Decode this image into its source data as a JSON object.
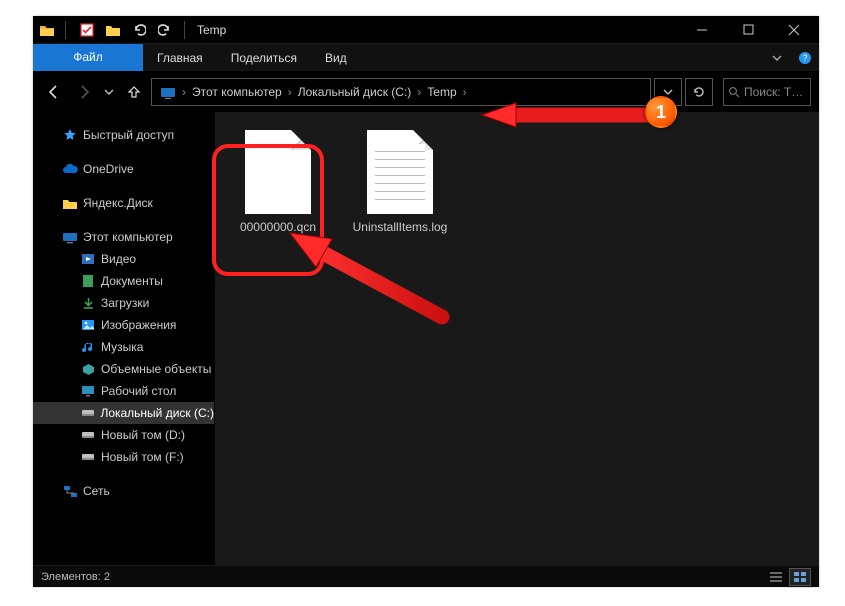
{
  "titlebar": {
    "title": "Temp"
  },
  "ribbon": {
    "file": "Файл",
    "home": "Главная",
    "share": "Поделиться",
    "view": "Вид"
  },
  "breadcrumbs": {
    "items": [
      "Этот компьютер",
      "Локальный диск (C:)",
      "Temp"
    ]
  },
  "search": {
    "placeholder": "Поиск: T…"
  },
  "nav": {
    "quick": "Быстрый доступ",
    "onedrive": "OneDrive",
    "yandex": "Яндекс.Диск",
    "thispc": "Этот компьютер",
    "thispc_children": [
      "Видео",
      "Документы",
      "Загрузки",
      "Изображения",
      "Музыка",
      "Объемные объекты",
      "Рабочий стол",
      "Локальный диск (C:)",
      "Новый том (D:)",
      "Новый том (F:)"
    ],
    "network": "Сеть"
  },
  "files": [
    {
      "name": "00000000.qcn"
    },
    {
      "name": "UninstallItems.log"
    }
  ],
  "status": {
    "label": "Элементов: 2"
  },
  "annotation": {
    "step": "1"
  }
}
